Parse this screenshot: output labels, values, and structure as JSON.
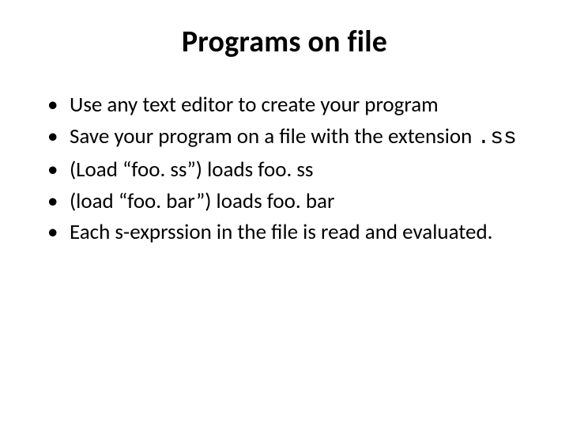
{
  "title": "Programs on file",
  "bullets": [
    {
      "pre": "Use any text editor to create your program"
    },
    {
      "pre": "Save your program on a file with the extension ",
      "mono": ".ss"
    },
    {
      "pre": "(Load “foo. ss”) loads foo. ss"
    },
    {
      "pre": "(load “foo. bar”) loads foo. bar"
    },
    {
      "pre": "Each s-exprssion in the file is read and evaluated."
    }
  ]
}
